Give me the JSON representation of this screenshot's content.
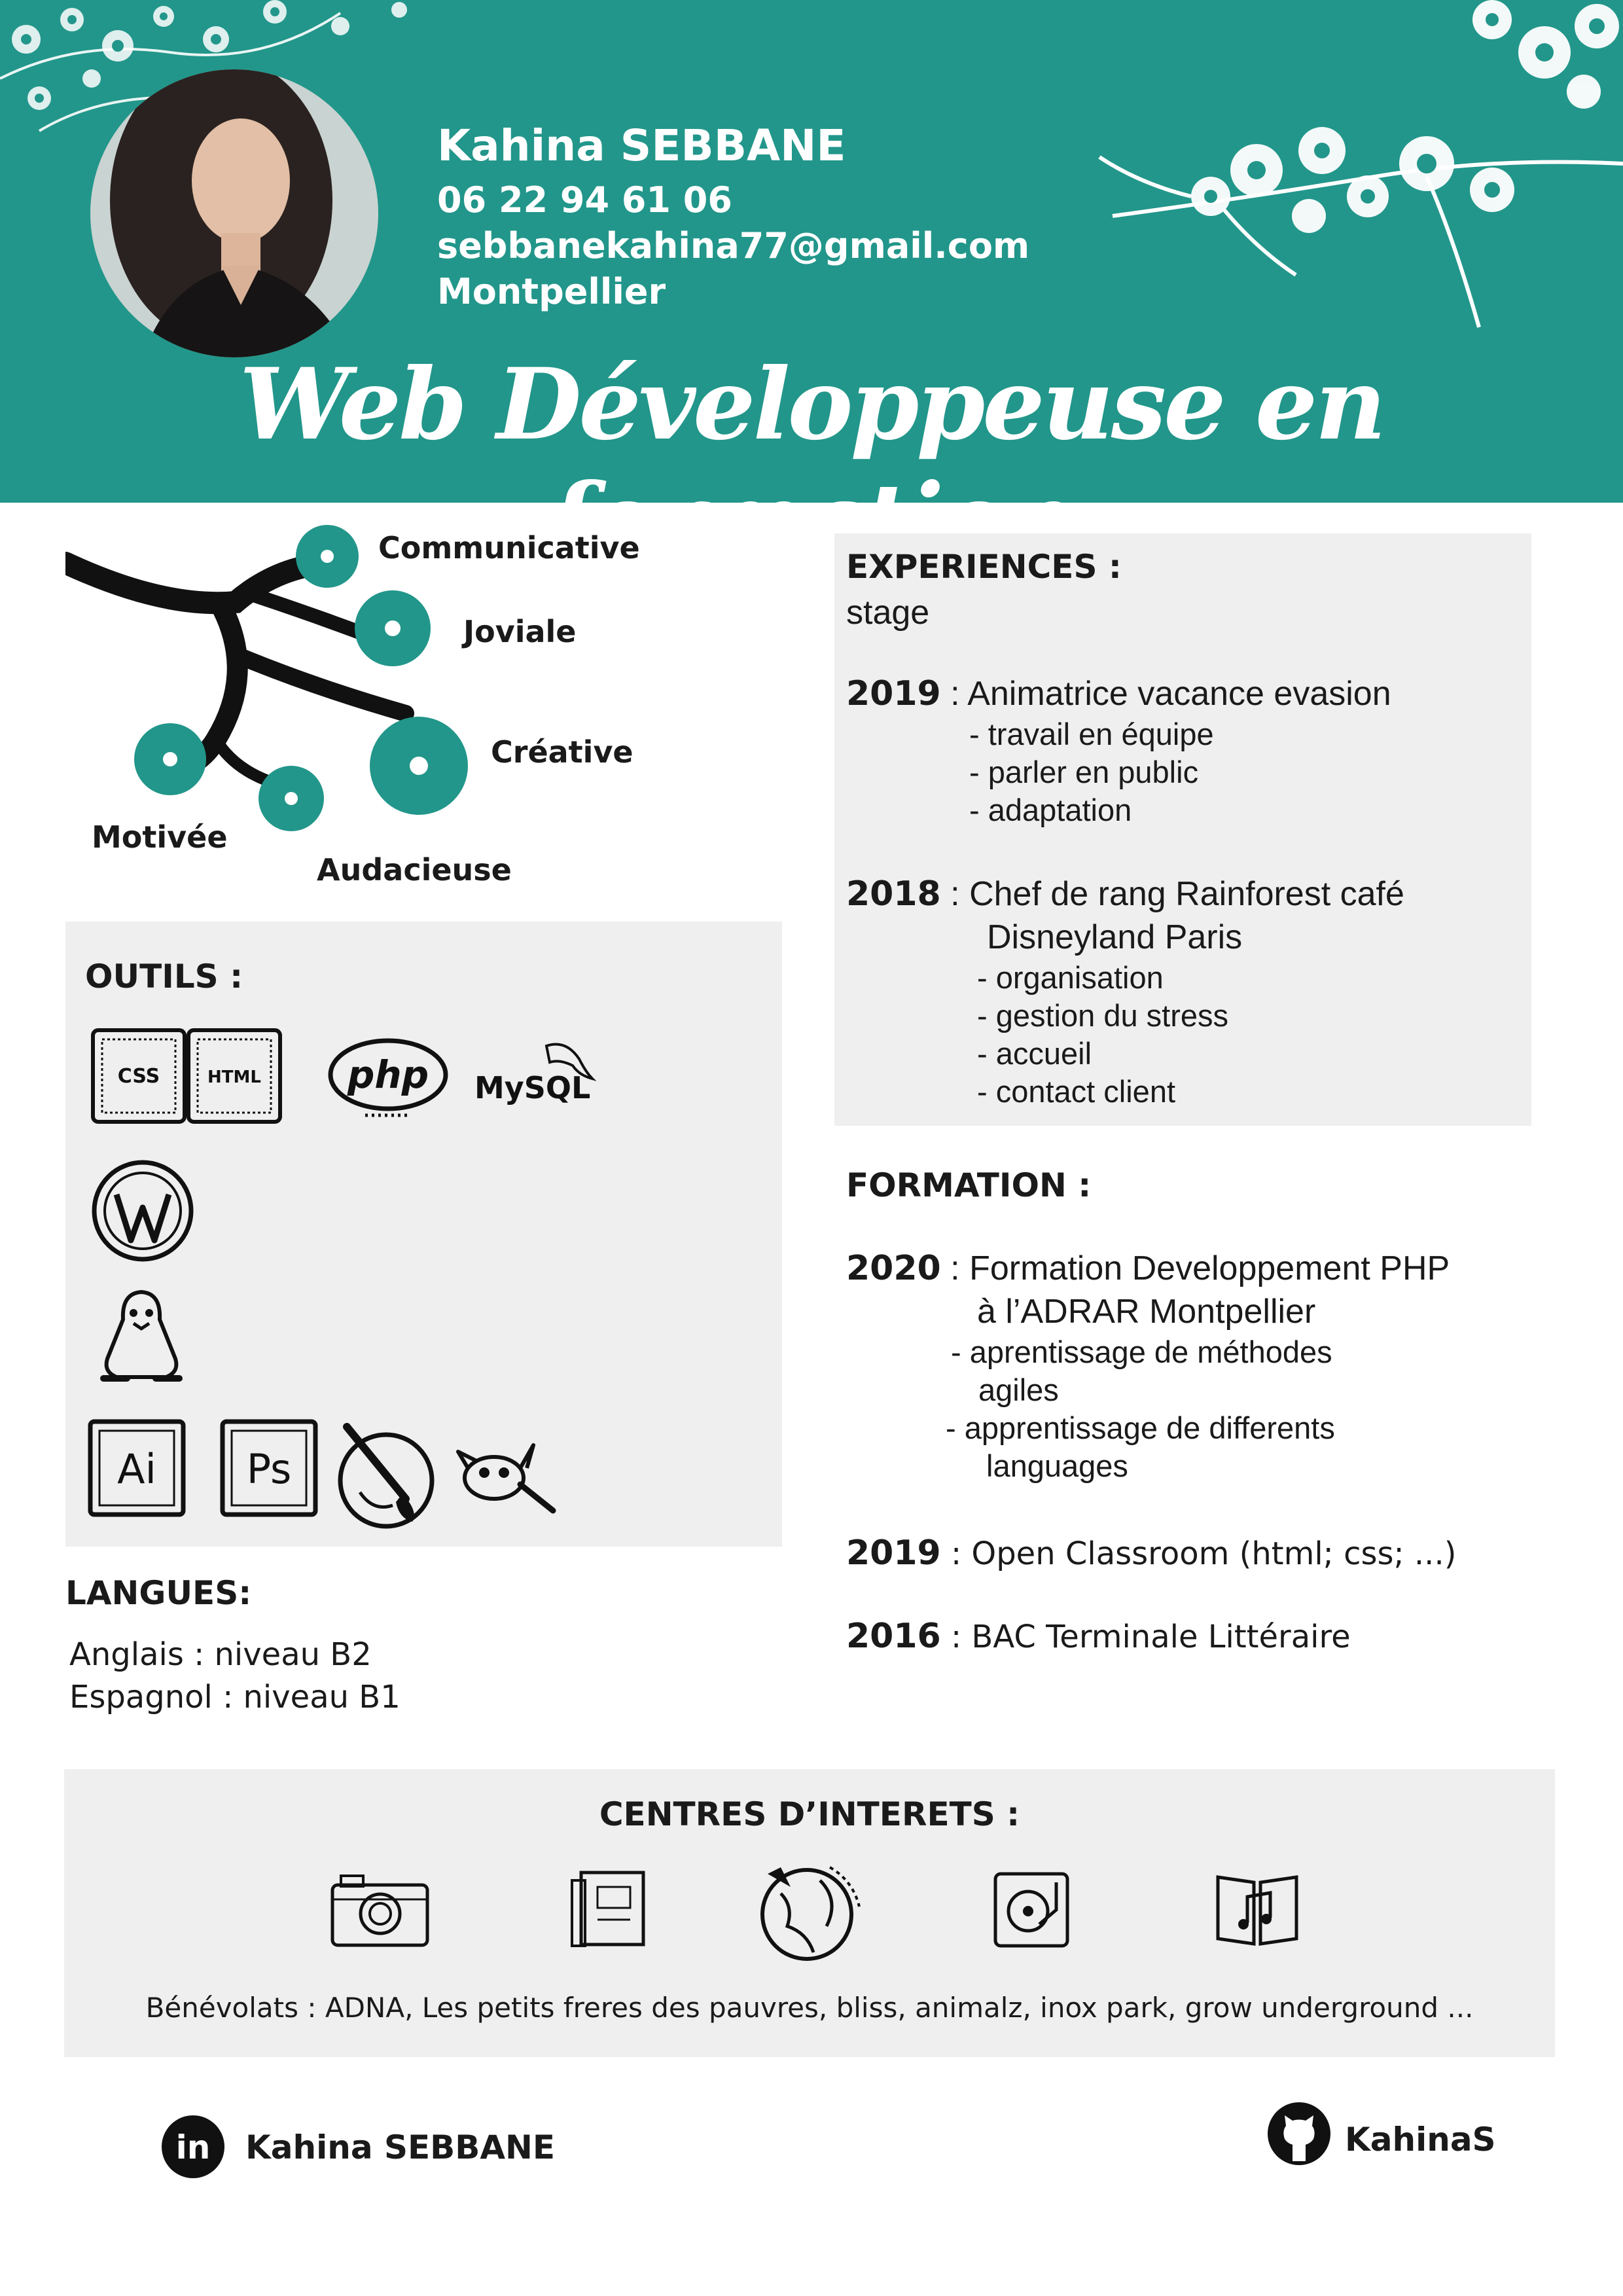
{
  "header": {
    "name": "Kahina SEBBANE",
    "phone": "06 22 94 61 06",
    "email": "sebbanekahina77@gmail.com",
    "city": "Montpellier",
    "title": "Web Développeuse en formation"
  },
  "qualities": {
    "communicative": "Communicative",
    "joviale": "Joviale",
    "creative": "Créative",
    "motivee": "Motivée",
    "audacieuse": "Audacieuse"
  },
  "outils": {
    "title": "OUTILS :",
    "icons": [
      "css-icon",
      "html-icon",
      "php-icon",
      "mysql-icon",
      "wordpress-icon",
      "linux-icon",
      "illustrator-icon",
      "photoshop-icon",
      "paint-icon",
      "gimp-icon"
    ],
    "css_label": "CSS",
    "html_label": "HTML",
    "php_label": "php",
    "mysql_label": "MySQL",
    "ai_label": "Ai",
    "ps_label": "Ps"
  },
  "experiences": {
    "title": "EXPERIENCES :",
    "subtitle": "stage",
    "items": [
      {
        "year": "2019",
        "role_lines": [
          " : Animatrice vacance evasion"
        ],
        "tasks": [
          "- travail en équipe",
          "- parler en public",
          "- adaptation"
        ]
      },
      {
        "year": "2018",
        "role_lines": [
          " : Chef de rang Rainforest café",
          "Disneyland Paris"
        ],
        "tasks": [
          "- organisation",
          "- gestion du stress",
          "- accueil",
          "- contact client"
        ]
      }
    ]
  },
  "formation": {
    "title": "FORMATION :",
    "items": [
      {
        "year": "2020",
        "lines": [
          " : Formation Developpement PHP",
          "à l’ADRAR Montpellier"
        ],
        "details": [
          "- aprentissage de méthodes",
          "agiles",
          "- apprentissage de differents",
          "languages"
        ]
      },
      {
        "year": "2019",
        "lines": [
          " :  Open Classroom (html; css; ...)"
        ]
      },
      {
        "year": "2016",
        "lines": [
          " :  BAC Terminale Littéraire"
        ]
      }
    ]
  },
  "langues": {
    "title": "LANGUES:",
    "items": [
      "Anglais :  niveau B2",
      "Espagnol : niveau B1"
    ]
  },
  "interets": {
    "title": "CENTRES D’INTERETS :",
    "icons": [
      "camera-icon",
      "books-icon",
      "globe-travel-icon",
      "turntable-icon",
      "music-book-icon"
    ],
    "benevolats": "Bénévolats : ADNA, Les petits freres des pauvres, bliss, animalz, inox park, grow underground ..."
  },
  "social": {
    "linkedin_icon_text": "in",
    "linkedin": "Kahina SEBBANE",
    "github": "KahinaS"
  },
  "colors": {
    "accent": "#22968a",
    "panel": "#efefef",
    "text": "#1a1a1a"
  }
}
